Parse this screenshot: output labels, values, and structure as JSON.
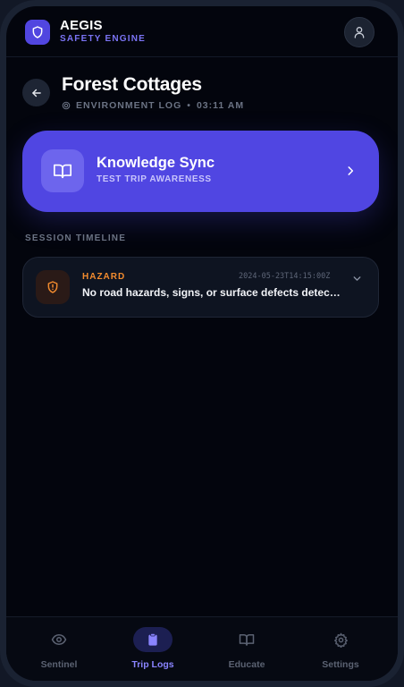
{
  "header": {
    "title": "AEGIS",
    "subtitle": "SAFETY ENGINE",
    "logo_icon": "shield-icon",
    "profile_icon": "user-icon"
  },
  "page": {
    "title": "Forest Cottages",
    "meta_label": "ENVIRONMENT LOG",
    "meta_separator": "•",
    "meta_time": "03:11 AM"
  },
  "sync_card": {
    "title": "Knowledge Sync",
    "subtitle": "TEST TRIP AWARENESS",
    "icon": "book-open-icon"
  },
  "timeline": {
    "section_label": "SESSION TIMELINE",
    "entries": [
      {
        "type": "HAZARD",
        "timestamp": "2024-05-23T14:15:00Z",
        "message": "No road hazards, signs, or surface defects detected in current frame.",
        "icon": "shield-alert-icon"
      }
    ]
  },
  "nav": {
    "items": [
      {
        "label": "Sentinel",
        "icon": "eye-icon",
        "active": false
      },
      {
        "label": "Trip Logs",
        "icon": "clipboard-icon",
        "active": true
      },
      {
        "label": "Educate",
        "icon": "book-open-icon",
        "active": false
      },
      {
        "label": "Settings",
        "icon": "gear-icon",
        "active": false
      }
    ]
  },
  "colors": {
    "accent": "#5046e2",
    "accent_text": "#8a84ff",
    "hazard": "#f28b2e",
    "background": "#03050d"
  }
}
